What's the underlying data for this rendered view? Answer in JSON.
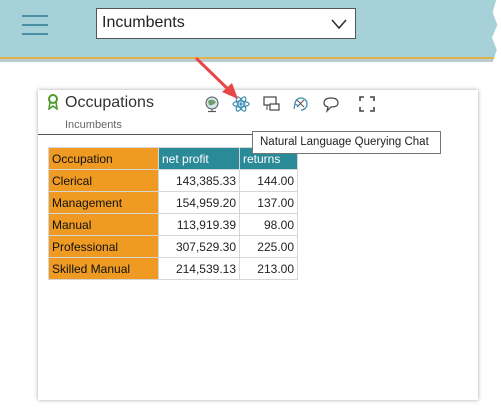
{
  "header": {
    "menu_icon": "hamburger-menu-icon",
    "dropdown": {
      "selected": "Incumbents",
      "icon": "chevron-down-icon"
    },
    "colors": {
      "bar": "#a6d1d8",
      "accent_line": "#e0b24a"
    }
  },
  "panel": {
    "title": "Occupations",
    "subtitle": "Incumbents",
    "title_icon": "ribbon-icon",
    "toolbar": [
      {
        "name": "globe-icon"
      },
      {
        "name": "atom-icon"
      },
      {
        "name": "presentation-icon"
      },
      {
        "name": "chat-refresh-icon"
      },
      {
        "name": "chat-bubble-icon"
      },
      {
        "name": "fullscreen-icon"
      }
    ],
    "tooltip": "Natural Language Querying Chat"
  },
  "table": {
    "columns": [
      "Occupation",
      "net profit",
      "returns"
    ],
    "rows": [
      [
        "Clerical",
        "143,385.33",
        "144.00"
      ],
      [
        "Management",
        "154,959.20",
        "137.00"
      ],
      [
        "Manual",
        "113,919.39",
        "98.00"
      ],
      [
        "Professional",
        "307,529.30",
        "225.00"
      ],
      [
        "Skilled Manual",
        "214,539.13",
        "213.00"
      ]
    ],
    "colors": {
      "category": "#ef9a22",
      "measure_header": "#2a8a98"
    }
  },
  "annotation": {
    "arrow_color": "#e8474a"
  }
}
